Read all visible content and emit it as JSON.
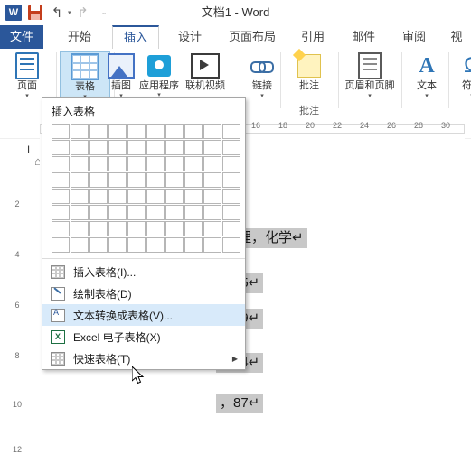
{
  "window": {
    "title": "文档1 - Word",
    "quick_access": {
      "word_logo": "W",
      "save_icon": "save-icon",
      "undo_label": "↰",
      "redo_label": "↱",
      "customize_label": "⌄"
    }
  },
  "ribbon": {
    "tabs": [
      {
        "label": "文件",
        "active": false,
        "file": true
      },
      {
        "label": "开始",
        "active": false
      },
      {
        "label": "插入",
        "active": true
      },
      {
        "label": "设计",
        "active": false
      },
      {
        "label": "页面布局",
        "active": false
      },
      {
        "label": "引用",
        "active": false
      },
      {
        "label": "邮件",
        "active": false
      },
      {
        "label": "审阅",
        "active": false
      },
      {
        "label": "视",
        "active": false
      }
    ],
    "items": [
      {
        "label": "页面",
        "icon": "page-icon",
        "caret": true
      },
      {
        "label": "表格",
        "icon": "table-icon",
        "caret": true,
        "selected": true
      },
      {
        "label": "插图",
        "icon": "picture-icon",
        "caret": true
      },
      {
        "label": "应用程序",
        "icon": "apps-icon",
        "caret": true
      },
      {
        "label": "联机视频",
        "icon": "online-video-icon",
        "caret": false
      },
      {
        "label": "链接",
        "icon": "link-icon",
        "caret": true
      },
      {
        "label": "批注",
        "icon": "comment-icon",
        "caret": false
      },
      {
        "label": "页眉和页脚",
        "icon": "header-footer-icon",
        "caret": true
      },
      {
        "label": "文本",
        "icon": "text-icon",
        "caret": true
      },
      {
        "label": "符号",
        "icon": "symbol-icon",
        "caret": true
      }
    ],
    "group_label_comment": "批注"
  },
  "menu": {
    "title": "插入表格",
    "grid": {
      "cols": 10,
      "rows": 8
    },
    "items": [
      {
        "label": "插入表格(I)...",
        "icon": "table-grid-icon",
        "highlight": false,
        "submenu": false
      },
      {
        "label": "绘制表格(D)",
        "icon": "draw-table-icon",
        "highlight": false,
        "submenu": false
      },
      {
        "label": "文本转换成表格(V)...",
        "icon": "convert-text-icon",
        "highlight": true,
        "submenu": false
      },
      {
        "label": "Excel 电子表格(X)",
        "icon": "excel-icon",
        "highlight": false,
        "submenu": false
      },
      {
        "label": "快速表格(T)",
        "icon": "quick-table-icon",
        "highlight": false,
        "submenu": true
      }
    ]
  },
  "ruler": {
    "horizontal_ticks": [
      "16",
      "18",
      "20",
      "22",
      "24",
      "26",
      "28",
      "30"
    ],
    "vertical_ticks": [
      "2",
      "4",
      "6",
      "8",
      "10",
      "12"
    ],
    "tab_marker": "L"
  },
  "document": {
    "lines": [
      {
        "text": "，物理，化学↵"
      },
      {
        "text": "，65↵"
      },
      {
        "text": "，59↵"
      },
      {
        "text": "，84↵"
      },
      {
        "text": "，87↵"
      }
    ]
  },
  "cursor": {
    "name": "mouse-pointer"
  }
}
